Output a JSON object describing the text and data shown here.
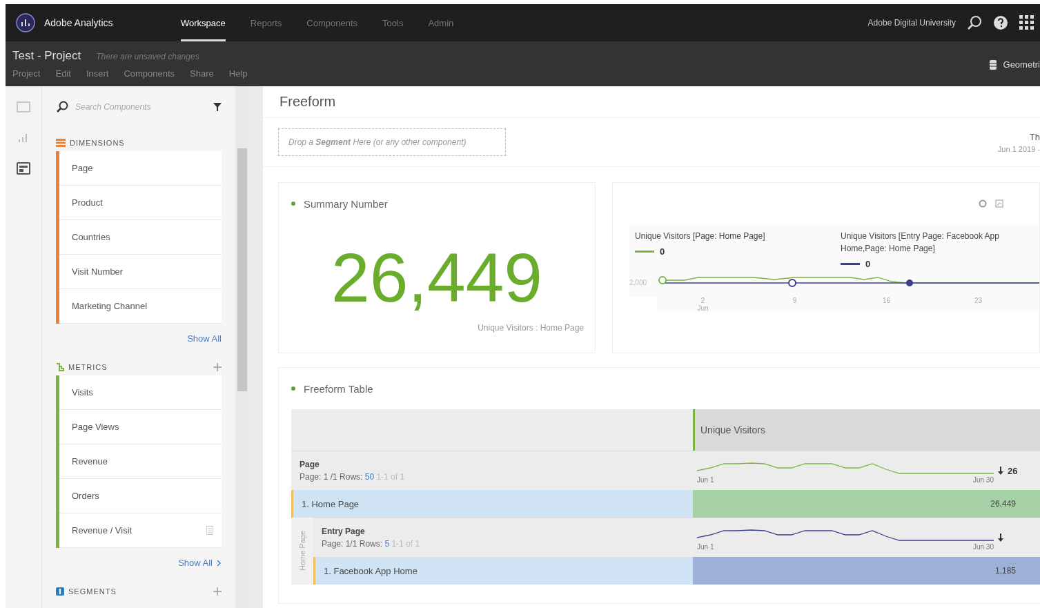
{
  "header": {
    "app_name": "Adobe Analytics",
    "nav": [
      {
        "label": "Workspace",
        "selected": true
      },
      {
        "label": "Reports",
        "selected": false
      },
      {
        "label": "Components",
        "selected": false
      },
      {
        "label": "Tools",
        "selected": false
      },
      {
        "label": "Admin",
        "selected": false
      }
    ],
    "org": "Adobe Digital University"
  },
  "project": {
    "title": "Test - Project",
    "status": "There are unsaved changes",
    "menu": [
      "Project",
      "Edit",
      "Insert",
      "Components",
      "Share",
      "Help"
    ],
    "report_suite": "Geometri"
  },
  "rail": [
    {
      "kind": "panel",
      "selected": false
    },
    {
      "kind": "visualization",
      "selected": false
    },
    {
      "kind": "components",
      "selected": true
    }
  ],
  "components": {
    "search_placeholder": "Search Components",
    "sections": [
      {
        "kind": "dimensions",
        "title": "DIMENSIONS",
        "color": "#e8843a",
        "addable": false,
        "items": [
          {
            "label": "Page",
            "calculated": false
          },
          {
            "label": "Product",
            "calculated": false
          },
          {
            "label": "Countries",
            "calculated": false
          },
          {
            "label": "Visit Number",
            "calculated": false
          },
          {
            "label": "Marketing Channel",
            "calculated": false
          }
        ],
        "show_all": "Show All",
        "chevron": false
      },
      {
        "kind": "metrics",
        "title": "METRICS",
        "color": "#7cb342",
        "addable": true,
        "items": [
          {
            "label": "Visits",
            "calculated": false
          },
          {
            "label": "Page Views",
            "calculated": false
          },
          {
            "label": "Revenue",
            "calculated": false
          },
          {
            "label": "Orders",
            "calculated": false
          },
          {
            "label": "Revenue / Visit",
            "calculated": true
          }
        ],
        "show_all": "Show All",
        "chevron": true
      },
      {
        "kind": "segments",
        "title": "SEGMENTS",
        "color": "#2d7fc1",
        "addable": true
      }
    ]
  },
  "panel": {
    "title": "Freeform",
    "drop_zone": "Drop a **Segment** Here (or any other component)",
    "date_title": "Th",
    "date_range": "Jun 1 2019 -"
  },
  "summary": {
    "title": "Summary Number",
    "value": "26,449",
    "caption": "Unique Visitors : Home Page"
  },
  "line": {
    "legends": [
      {
        "label": "Unique Visitors [Page: Home Page]",
        "value": "0",
        "color": "#7cb342"
      },
      {
        "label": "Unique Visitors [Entry Page: Facebook App Home,Page: Home Page]",
        "value": "0",
        "color": "#3b3f8f"
      }
    ],
    "y_tick": "2,000",
    "x_ticks": [
      "2",
      "9",
      "16",
      "23"
    ],
    "x_month": "Jun"
  },
  "table": {
    "title": "Freeform Table",
    "column": "Unique Visitors",
    "dimension": "Page",
    "meta": "Page: 1 /1 Rows:",
    "rows_count": "50",
    "range": "1-1 of 1",
    "spark_start": "Jun 1",
    "spark_end": "Jun 30",
    "total": "26",
    "rows": [
      {
        "label": "1. Home Page",
        "value": "26,449",
        "breakdown": {
          "side_label": "Home Page",
          "dimension": "Entry Page",
          "meta": "Page: 1/1 Rows:",
          "rows_count": "5",
          "range": "1-1 of 1",
          "spark_start": "Jun 1",
          "spark_end": "Jun 30",
          "rows": [
            {
              "label": "1. Facebook App Home",
              "value": "1,185"
            }
          ]
        }
      }
    ]
  }
}
